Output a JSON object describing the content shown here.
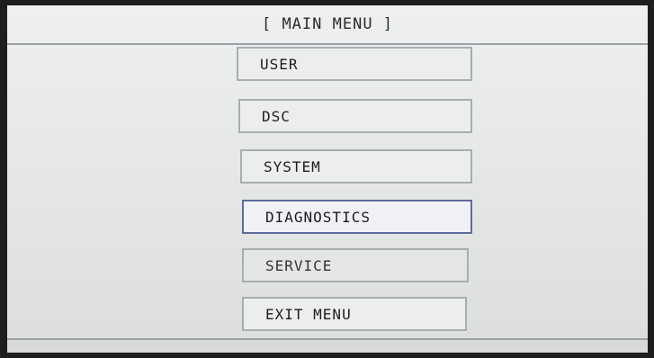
{
  "header": {
    "title": "[ MAIN MENU ]"
  },
  "menu": {
    "items": [
      {
        "label": "USER"
      },
      {
        "label": "DSC"
      },
      {
        "label": "SYSTEM"
      },
      {
        "label": "DIAGNOSTICS"
      },
      {
        "label": "SERVICE"
      },
      {
        "label": "EXIT MENU"
      }
    ],
    "selected": "DIAGNOSTICS"
  }
}
